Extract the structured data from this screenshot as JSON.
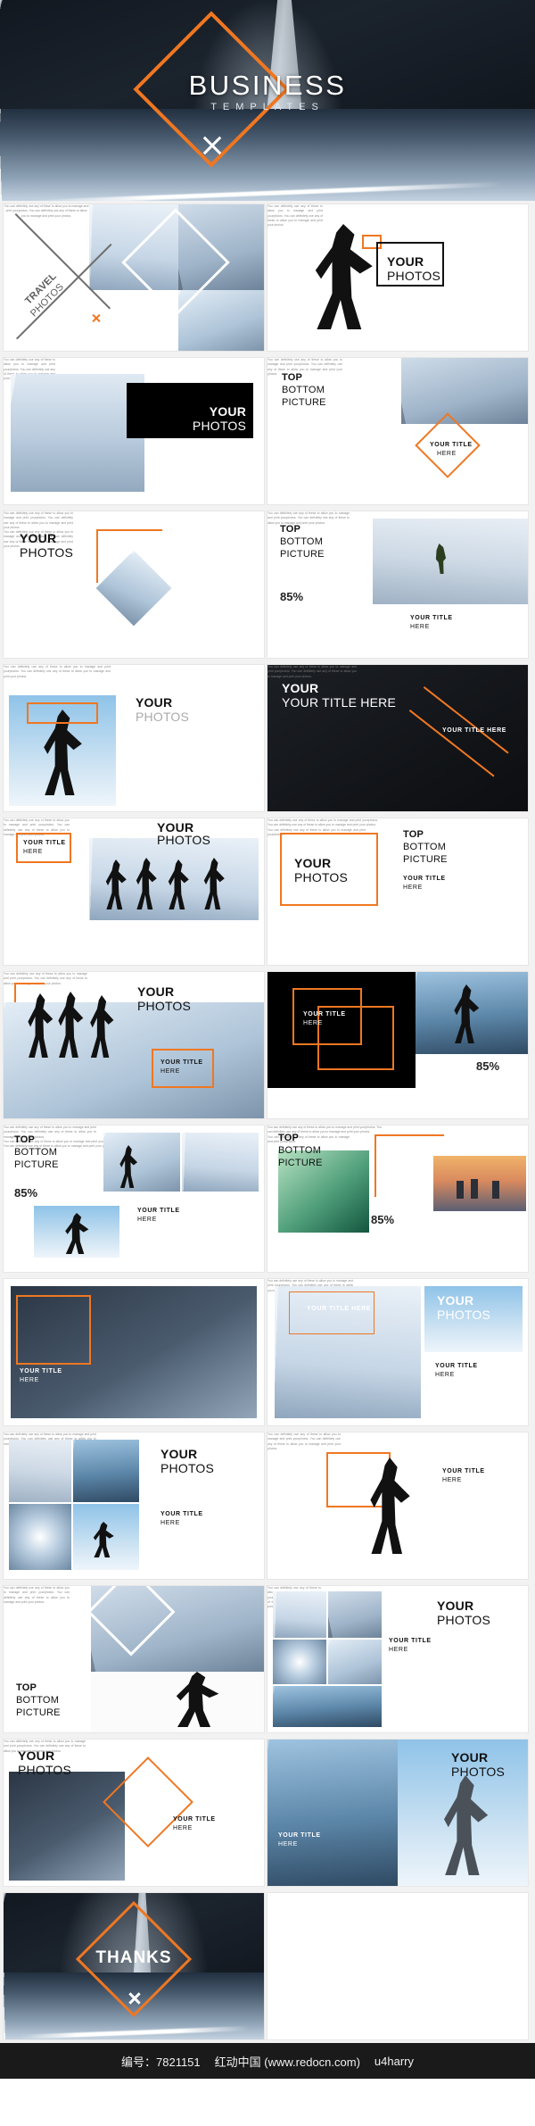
{
  "hero": {
    "title": "BUSINESS",
    "subtitle": "TEMPLATES",
    "accent_color": "#ef7722"
  },
  "labels": {
    "your_photos_1": "YOUR",
    "your_photos_2": "PHOTOS",
    "your_title_1": "YOUR TITLE",
    "your_title_2": "HERE",
    "your_title_here": "YOUR TITLE HERE",
    "travel_1": "TRAVEL",
    "travel_2": "PHOTOS",
    "top": "TOP",
    "bottom": "BOTTOM",
    "picture": "PICTURE",
    "percent": "85%",
    "thanks": "THANKS",
    "plus": "+"
  },
  "body_text": "You can definitely use any of these to allow you to manage and print yourphotos. You can definitely use any of these to allow you to manage and print your photos.",
  "body_text_short": "You can definitely use any of these to allow you to manage and print yourphotos.",
  "footer": {
    "id_label": "编号：7821151",
    "site": "红动中国 (www.redocn.com)",
    "author": "u4harry"
  }
}
